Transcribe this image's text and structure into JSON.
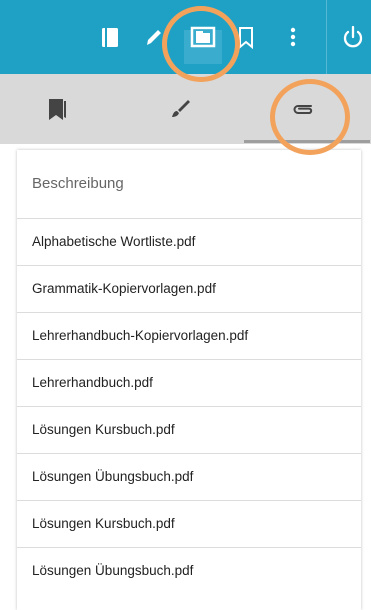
{
  "toolbar": {
    "icons": [
      "book-icon",
      "pencil-icon",
      "presentation-icon",
      "bookmark-icon",
      "more-vertical-icon",
      "power-icon"
    ],
    "background_color": "#1fa1c6"
  },
  "tabs": {
    "items": [
      {
        "icon": "bookmarks-icon",
        "active": false
      },
      {
        "icon": "brush-icon",
        "active": false
      },
      {
        "icon": "paperclip-icon",
        "active": true
      }
    ],
    "background_color": "#d9d9d9"
  },
  "attachments": {
    "header": "Beschreibung",
    "items": [
      "Alphabetische Wortliste.pdf",
      "Grammatik-Kopiervorlagen.pdf",
      "Lehrerhandbuch-Kopiervorlagen.pdf",
      "Lehrerhandbuch.pdf",
      "Lösungen Kursbuch.pdf",
      "Lösungen Übungsbuch.pdf",
      "Lösungen Kursbuch.pdf",
      "Lösungen Übungsbuch.pdf"
    ]
  },
  "annotation_color": "#f3a25b"
}
